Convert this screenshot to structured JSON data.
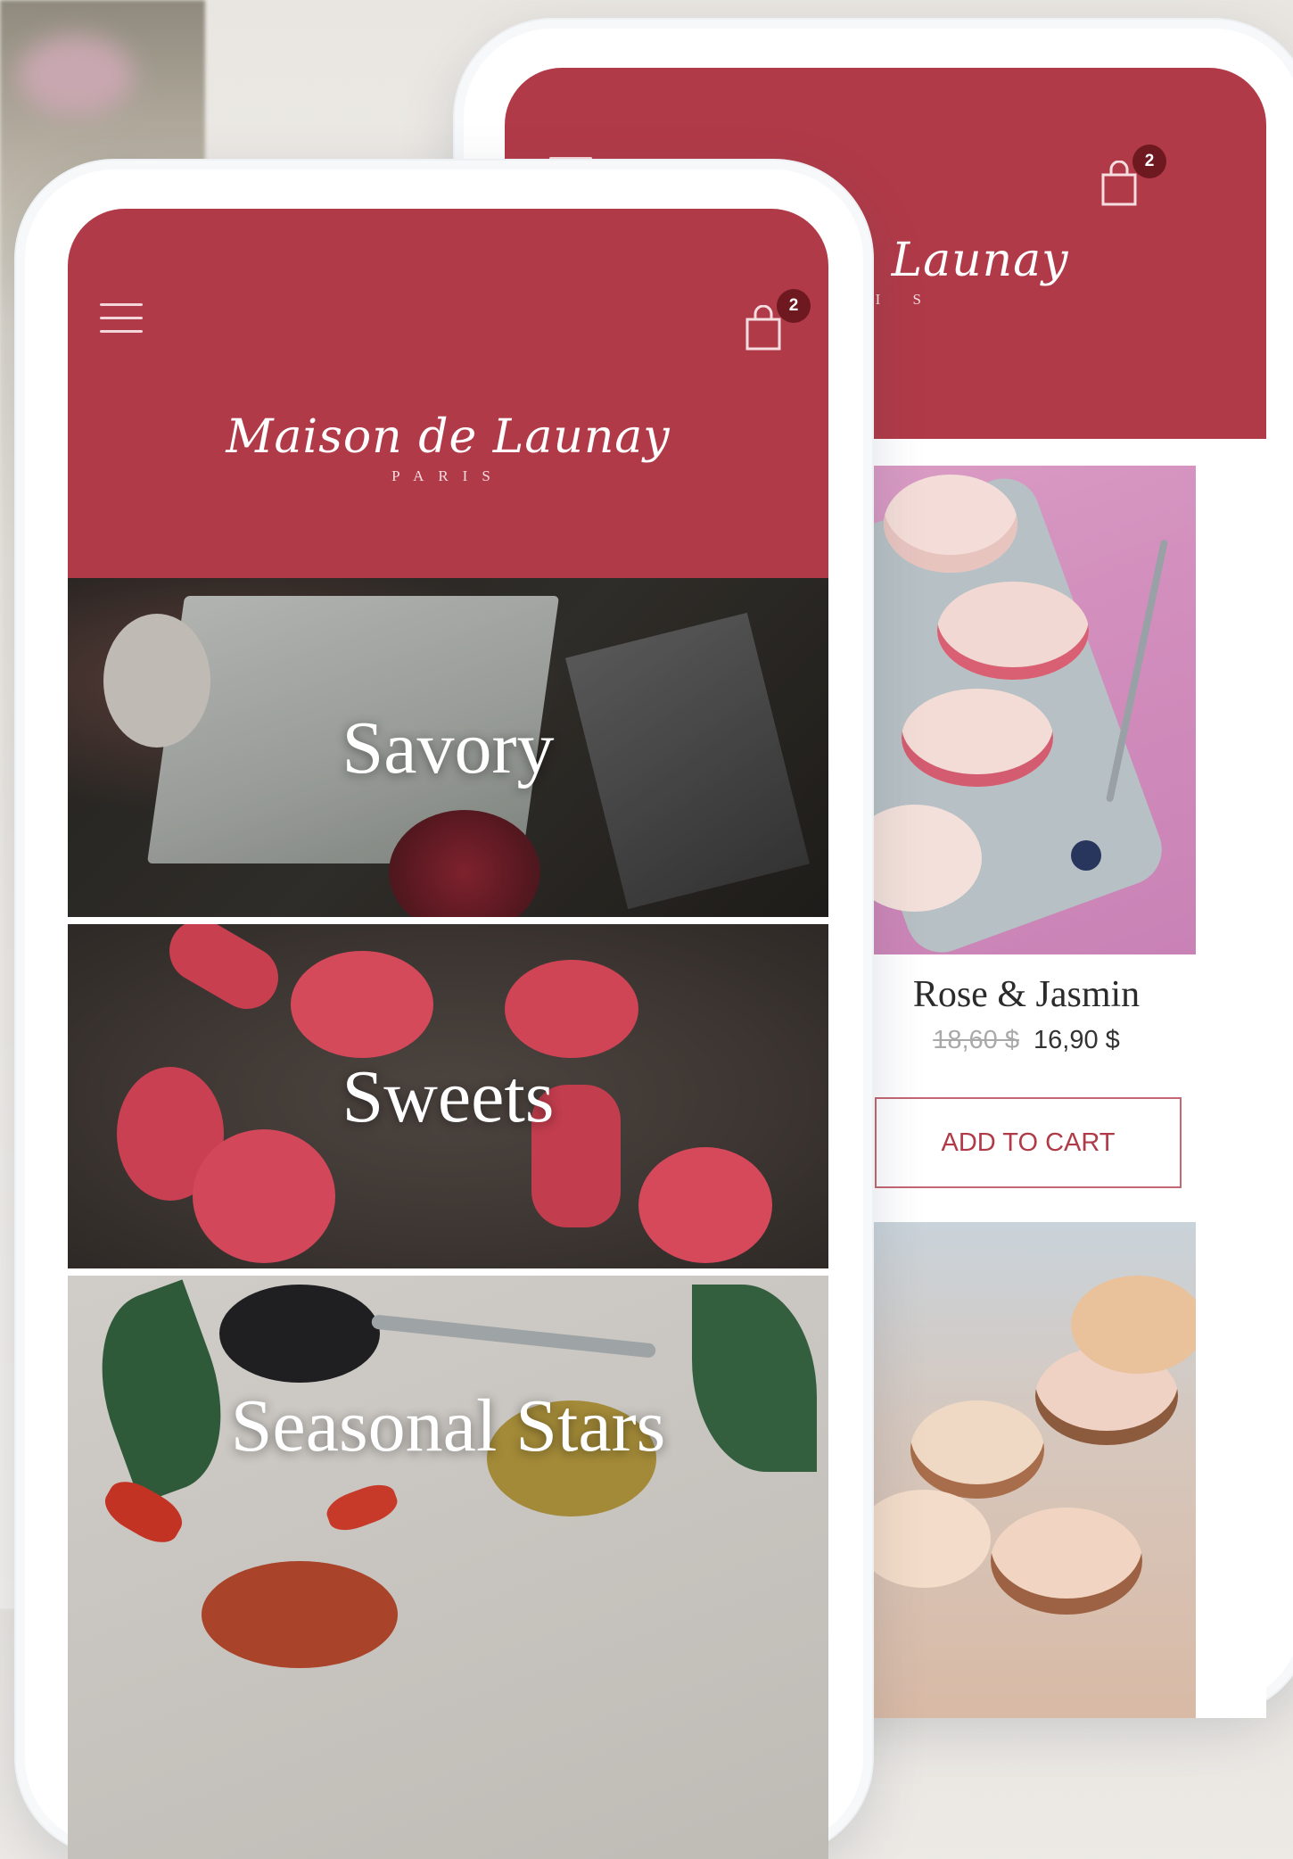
{
  "app": {
    "brand_name": "Maison de Launay",
    "brand_city": "PARIS",
    "brand_name_cropped": "de Launay",
    "brand_city_cropped": "R I S",
    "accent_color": "#b13a48",
    "badge_color": "#6e1820"
  },
  "header": {
    "menu_icon": "hamburger-menu-icon",
    "cart_icon": "shopping-bag-icon",
    "cart_count": "2"
  },
  "categories": [
    {
      "label": "Savory"
    },
    {
      "label": "Sweets"
    },
    {
      "label": "Seasonal Stars"
    }
  ],
  "product": {
    "name": "Rose & Jasmin",
    "price_old": "18,60 $",
    "price_new": "16,90 $",
    "add_to_cart": "ADD TO CART"
  }
}
